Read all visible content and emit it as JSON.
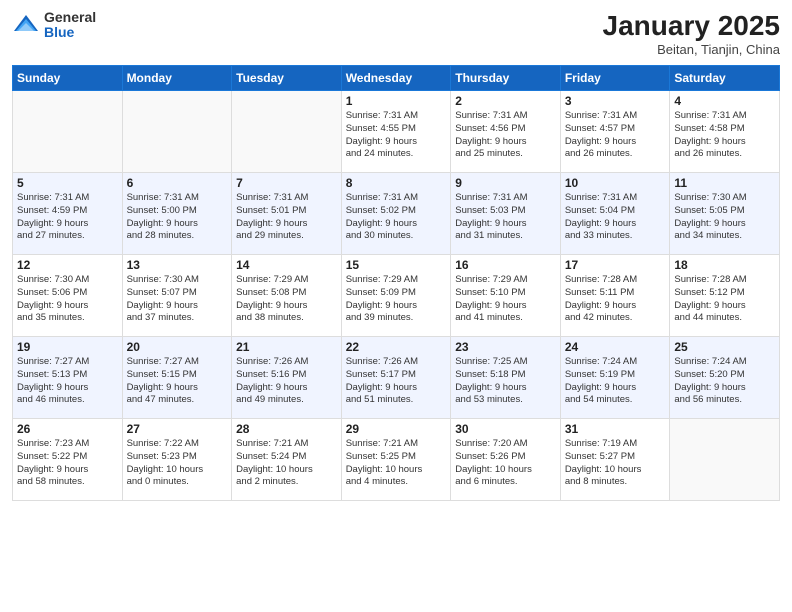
{
  "header": {
    "logo_general": "General",
    "logo_blue": "Blue",
    "title": "January 2025",
    "subtitle": "Beitan, Tianjin, China"
  },
  "weekdays": [
    "Sunday",
    "Monday",
    "Tuesday",
    "Wednesday",
    "Thursday",
    "Friday",
    "Saturday"
  ],
  "weeks": [
    [
      {
        "day": "",
        "info": ""
      },
      {
        "day": "",
        "info": ""
      },
      {
        "day": "",
        "info": ""
      },
      {
        "day": "1",
        "info": "Sunrise: 7:31 AM\nSunset: 4:55 PM\nDaylight: 9 hours\nand 24 minutes."
      },
      {
        "day": "2",
        "info": "Sunrise: 7:31 AM\nSunset: 4:56 PM\nDaylight: 9 hours\nand 25 minutes."
      },
      {
        "day": "3",
        "info": "Sunrise: 7:31 AM\nSunset: 4:57 PM\nDaylight: 9 hours\nand 26 minutes."
      },
      {
        "day": "4",
        "info": "Sunrise: 7:31 AM\nSunset: 4:58 PM\nDaylight: 9 hours\nand 26 minutes."
      }
    ],
    [
      {
        "day": "5",
        "info": "Sunrise: 7:31 AM\nSunset: 4:59 PM\nDaylight: 9 hours\nand 27 minutes."
      },
      {
        "day": "6",
        "info": "Sunrise: 7:31 AM\nSunset: 5:00 PM\nDaylight: 9 hours\nand 28 minutes."
      },
      {
        "day": "7",
        "info": "Sunrise: 7:31 AM\nSunset: 5:01 PM\nDaylight: 9 hours\nand 29 minutes."
      },
      {
        "day": "8",
        "info": "Sunrise: 7:31 AM\nSunset: 5:02 PM\nDaylight: 9 hours\nand 30 minutes."
      },
      {
        "day": "9",
        "info": "Sunrise: 7:31 AM\nSunset: 5:03 PM\nDaylight: 9 hours\nand 31 minutes."
      },
      {
        "day": "10",
        "info": "Sunrise: 7:31 AM\nSunset: 5:04 PM\nDaylight: 9 hours\nand 33 minutes."
      },
      {
        "day": "11",
        "info": "Sunrise: 7:30 AM\nSunset: 5:05 PM\nDaylight: 9 hours\nand 34 minutes."
      }
    ],
    [
      {
        "day": "12",
        "info": "Sunrise: 7:30 AM\nSunset: 5:06 PM\nDaylight: 9 hours\nand 35 minutes."
      },
      {
        "day": "13",
        "info": "Sunrise: 7:30 AM\nSunset: 5:07 PM\nDaylight: 9 hours\nand 37 minutes."
      },
      {
        "day": "14",
        "info": "Sunrise: 7:29 AM\nSunset: 5:08 PM\nDaylight: 9 hours\nand 38 minutes."
      },
      {
        "day": "15",
        "info": "Sunrise: 7:29 AM\nSunset: 5:09 PM\nDaylight: 9 hours\nand 39 minutes."
      },
      {
        "day": "16",
        "info": "Sunrise: 7:29 AM\nSunset: 5:10 PM\nDaylight: 9 hours\nand 41 minutes."
      },
      {
        "day": "17",
        "info": "Sunrise: 7:28 AM\nSunset: 5:11 PM\nDaylight: 9 hours\nand 42 minutes."
      },
      {
        "day": "18",
        "info": "Sunrise: 7:28 AM\nSunset: 5:12 PM\nDaylight: 9 hours\nand 44 minutes."
      }
    ],
    [
      {
        "day": "19",
        "info": "Sunrise: 7:27 AM\nSunset: 5:13 PM\nDaylight: 9 hours\nand 46 minutes."
      },
      {
        "day": "20",
        "info": "Sunrise: 7:27 AM\nSunset: 5:15 PM\nDaylight: 9 hours\nand 47 minutes."
      },
      {
        "day": "21",
        "info": "Sunrise: 7:26 AM\nSunset: 5:16 PM\nDaylight: 9 hours\nand 49 minutes."
      },
      {
        "day": "22",
        "info": "Sunrise: 7:26 AM\nSunset: 5:17 PM\nDaylight: 9 hours\nand 51 minutes."
      },
      {
        "day": "23",
        "info": "Sunrise: 7:25 AM\nSunset: 5:18 PM\nDaylight: 9 hours\nand 53 minutes."
      },
      {
        "day": "24",
        "info": "Sunrise: 7:24 AM\nSunset: 5:19 PM\nDaylight: 9 hours\nand 54 minutes."
      },
      {
        "day": "25",
        "info": "Sunrise: 7:24 AM\nSunset: 5:20 PM\nDaylight: 9 hours\nand 56 minutes."
      }
    ],
    [
      {
        "day": "26",
        "info": "Sunrise: 7:23 AM\nSunset: 5:22 PM\nDaylight: 9 hours\nand 58 minutes."
      },
      {
        "day": "27",
        "info": "Sunrise: 7:22 AM\nSunset: 5:23 PM\nDaylight: 10 hours\nand 0 minutes."
      },
      {
        "day": "28",
        "info": "Sunrise: 7:21 AM\nSunset: 5:24 PM\nDaylight: 10 hours\nand 2 minutes."
      },
      {
        "day": "29",
        "info": "Sunrise: 7:21 AM\nSunset: 5:25 PM\nDaylight: 10 hours\nand 4 minutes."
      },
      {
        "day": "30",
        "info": "Sunrise: 7:20 AM\nSunset: 5:26 PM\nDaylight: 10 hours\nand 6 minutes."
      },
      {
        "day": "31",
        "info": "Sunrise: 7:19 AM\nSunset: 5:27 PM\nDaylight: 10 hours\nand 8 minutes."
      },
      {
        "day": "",
        "info": ""
      }
    ]
  ]
}
